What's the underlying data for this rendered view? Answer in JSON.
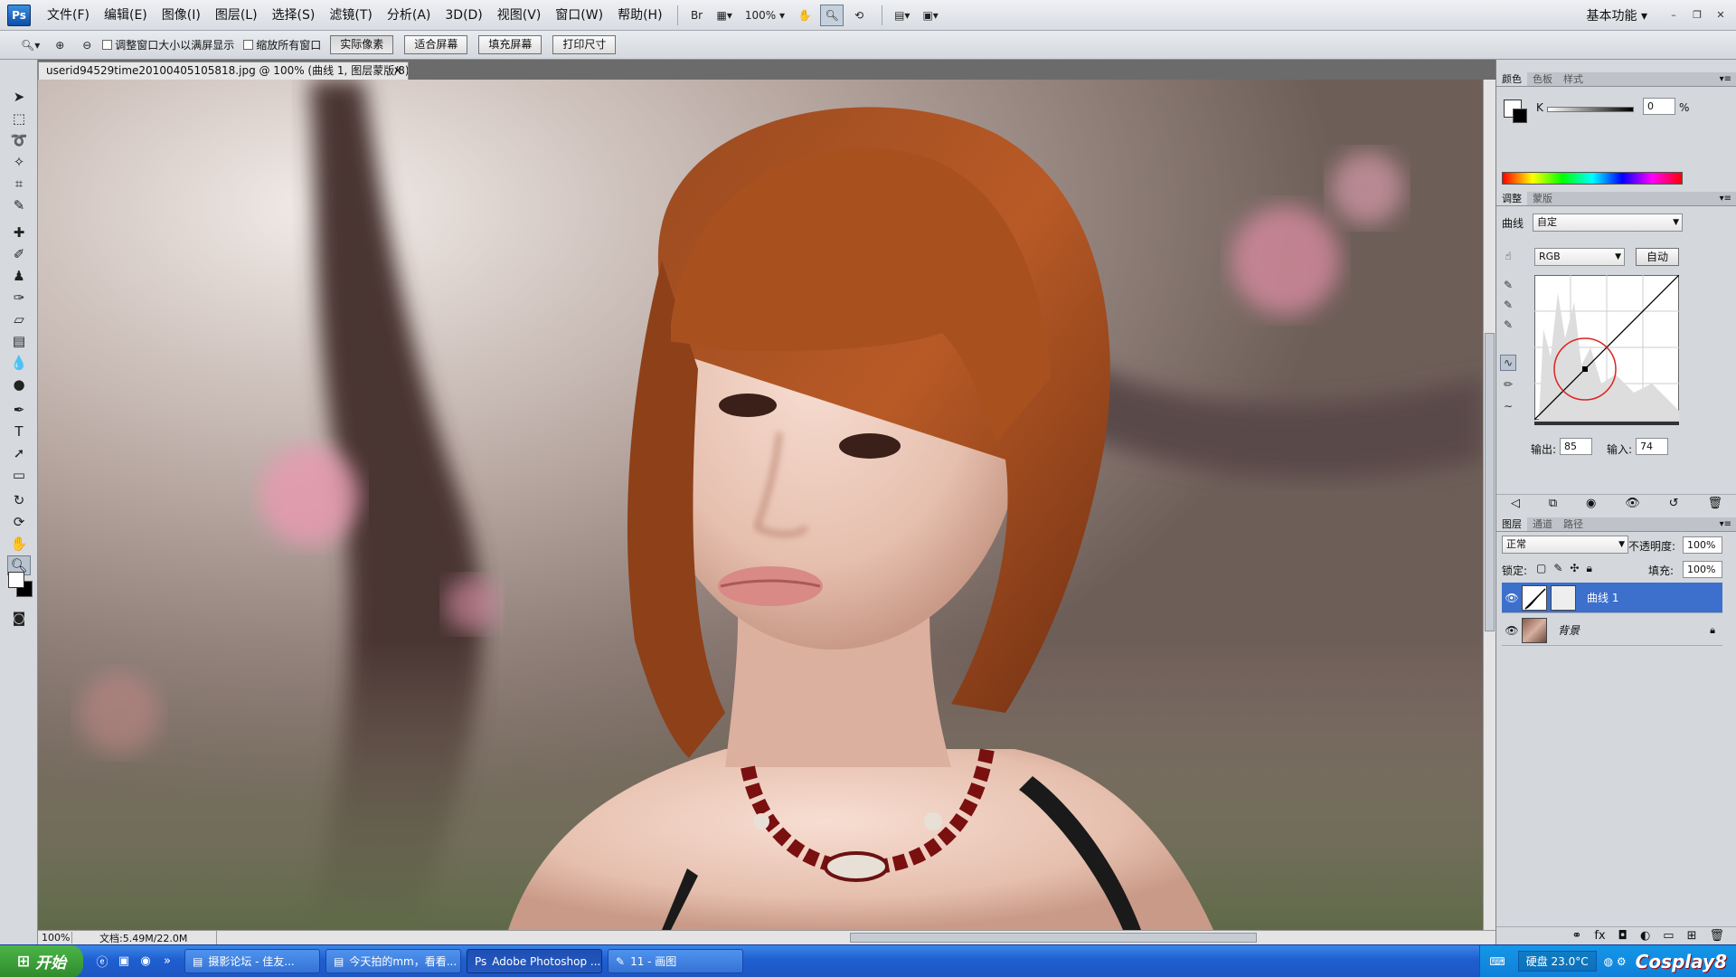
{
  "app": {
    "logo": "Ps"
  },
  "menu": [
    "文件(F)",
    "编辑(E)",
    "图像(I)",
    "图层(L)",
    "选择(S)",
    "滤镜(T)",
    "分析(A)",
    "3D(D)",
    "视图(V)",
    "窗口(W)",
    "帮助(H)"
  ],
  "menubar_controls": {
    "bridge": "Br",
    "zoom": "100%",
    "workspace": "基本功能"
  },
  "options": {
    "resize_windows": "调整窗口大小以满屏显示",
    "zoom_all": "缩放所有窗口",
    "actual_pixels": "实际像素",
    "fit_screen": "适合屏幕",
    "fill_screen": "填充屏幕",
    "print_size": "打印尺寸"
  },
  "document": {
    "tab_title": "userid94529time20100405105818.jpg @ 100% (曲线 1, 图层蒙版/8) *",
    "zoom_status": "100%",
    "doc_status": "文档:5.49M/22.0M"
  },
  "color_panel": {
    "tabs": [
      "颜色",
      "色板",
      "样式"
    ],
    "channel": "K",
    "value": "0",
    "unit": "%"
  },
  "adjust_panel": {
    "tabs": [
      "调整",
      "蒙版"
    ],
    "curves_label": "曲线",
    "preset": "自定",
    "channel": "RGB",
    "auto": "自动",
    "output_label": "输出:",
    "output_value": "85",
    "input_label": "输入:",
    "input_value": "74"
  },
  "layers_panel": {
    "tabs": [
      "图层",
      "通道",
      "路径"
    ],
    "blend_mode": "正常",
    "opacity_label": "不透明度:",
    "opacity_value": "100%",
    "lock_label": "锁定:",
    "fill_label": "填充:",
    "fill_value": "100%",
    "layers": [
      {
        "name": "曲线 1",
        "selected": true
      },
      {
        "name": "背景",
        "selected": false
      }
    ]
  },
  "taskbar": {
    "start": "开始",
    "tasks": [
      "摄影论坛 - 佳友...",
      "今天拍的mm，看看...",
      "Adobe Photoshop ...",
      "11 - 画图"
    ],
    "disk": "硬盘 23.0°C",
    "watermark": "Cosplay8"
  },
  "colors": {
    "selection": "#3d6fcc",
    "taskbar": "#1f5fd0",
    "start": "#2f8a2c"
  }
}
